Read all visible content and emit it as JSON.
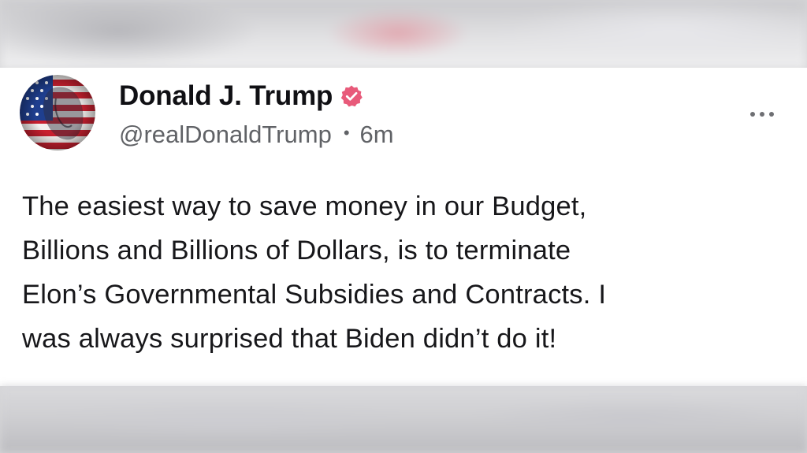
{
  "post": {
    "author": {
      "display_name": "Donald J. Trump",
      "handle": "@realDonaldTrump",
      "verified": true,
      "verified_color": "#e85a7a",
      "avatar_icon": "flag-portrait-avatar"
    },
    "separator": "•",
    "time": "6m",
    "more_icon": "more-horizontal-icon",
    "text_lines": [
      "The easiest way to save money in our Budget,",
      "Billions and Billions of Dollars, is to terminate",
      "Elon’s Governmental Subsidies and Contracts. I",
      "was always surprised that Biden didn’t do it!"
    ]
  }
}
